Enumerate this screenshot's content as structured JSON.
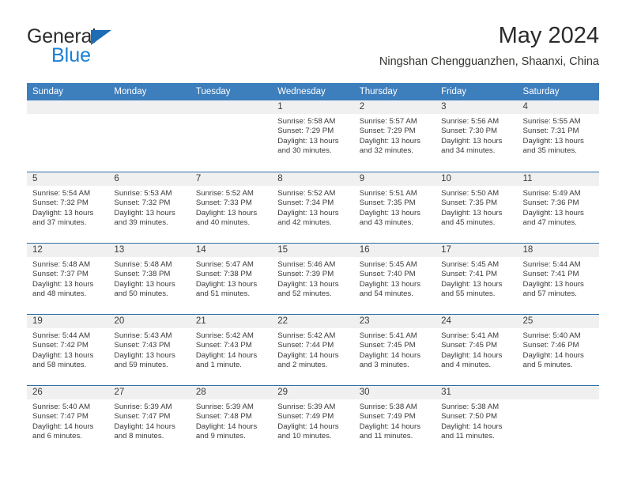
{
  "brand": {
    "name_top": "General",
    "name_bottom": "Blue",
    "triangle_color": "#1e6cb5",
    "blue_text_color": "#1a7fd4"
  },
  "header": {
    "title": "May 2024",
    "subtitle": "Ningshan Chengguanzhen, Shaanxi, China"
  },
  "theme": {
    "header_bar_color": "#3d7ebd",
    "row_divider_color": "#2e6fa8",
    "date_band_color": "#f0f0f0",
    "text_color": "#3a3a3a"
  },
  "weekdays": [
    "Sunday",
    "Monday",
    "Tuesday",
    "Wednesday",
    "Thursday",
    "Friday",
    "Saturday"
  ],
  "weeks": [
    [
      {
        "day": "",
        "empty": true
      },
      {
        "day": "",
        "empty": true
      },
      {
        "day": "",
        "empty": true
      },
      {
        "day": "1",
        "sunrise": "Sunrise: 5:58 AM",
        "sunset": "Sunset: 7:29 PM",
        "daylight": "Daylight: 13 hours and 30 minutes."
      },
      {
        "day": "2",
        "sunrise": "Sunrise: 5:57 AM",
        "sunset": "Sunset: 7:29 PM",
        "daylight": "Daylight: 13 hours and 32 minutes."
      },
      {
        "day": "3",
        "sunrise": "Sunrise: 5:56 AM",
        "sunset": "Sunset: 7:30 PM",
        "daylight": "Daylight: 13 hours and 34 minutes."
      },
      {
        "day": "4",
        "sunrise": "Sunrise: 5:55 AM",
        "sunset": "Sunset: 7:31 PM",
        "daylight": "Daylight: 13 hours and 35 minutes."
      }
    ],
    [
      {
        "day": "5",
        "sunrise": "Sunrise: 5:54 AM",
        "sunset": "Sunset: 7:32 PM",
        "daylight": "Daylight: 13 hours and 37 minutes."
      },
      {
        "day": "6",
        "sunrise": "Sunrise: 5:53 AM",
        "sunset": "Sunset: 7:32 PM",
        "daylight": "Daylight: 13 hours and 39 minutes."
      },
      {
        "day": "7",
        "sunrise": "Sunrise: 5:52 AM",
        "sunset": "Sunset: 7:33 PM",
        "daylight": "Daylight: 13 hours and 40 minutes."
      },
      {
        "day": "8",
        "sunrise": "Sunrise: 5:52 AM",
        "sunset": "Sunset: 7:34 PM",
        "daylight": "Daylight: 13 hours and 42 minutes."
      },
      {
        "day": "9",
        "sunrise": "Sunrise: 5:51 AM",
        "sunset": "Sunset: 7:35 PM",
        "daylight": "Daylight: 13 hours and 43 minutes."
      },
      {
        "day": "10",
        "sunrise": "Sunrise: 5:50 AM",
        "sunset": "Sunset: 7:35 PM",
        "daylight": "Daylight: 13 hours and 45 minutes."
      },
      {
        "day": "11",
        "sunrise": "Sunrise: 5:49 AM",
        "sunset": "Sunset: 7:36 PM",
        "daylight": "Daylight: 13 hours and 47 minutes."
      }
    ],
    [
      {
        "day": "12",
        "sunrise": "Sunrise: 5:48 AM",
        "sunset": "Sunset: 7:37 PM",
        "daylight": "Daylight: 13 hours and 48 minutes."
      },
      {
        "day": "13",
        "sunrise": "Sunrise: 5:48 AM",
        "sunset": "Sunset: 7:38 PM",
        "daylight": "Daylight: 13 hours and 50 minutes."
      },
      {
        "day": "14",
        "sunrise": "Sunrise: 5:47 AM",
        "sunset": "Sunset: 7:38 PM",
        "daylight": "Daylight: 13 hours and 51 minutes."
      },
      {
        "day": "15",
        "sunrise": "Sunrise: 5:46 AM",
        "sunset": "Sunset: 7:39 PM",
        "daylight": "Daylight: 13 hours and 52 minutes."
      },
      {
        "day": "16",
        "sunrise": "Sunrise: 5:45 AM",
        "sunset": "Sunset: 7:40 PM",
        "daylight": "Daylight: 13 hours and 54 minutes."
      },
      {
        "day": "17",
        "sunrise": "Sunrise: 5:45 AM",
        "sunset": "Sunset: 7:41 PM",
        "daylight": "Daylight: 13 hours and 55 minutes."
      },
      {
        "day": "18",
        "sunrise": "Sunrise: 5:44 AM",
        "sunset": "Sunset: 7:41 PM",
        "daylight": "Daylight: 13 hours and 57 minutes."
      }
    ],
    [
      {
        "day": "19",
        "sunrise": "Sunrise: 5:44 AM",
        "sunset": "Sunset: 7:42 PM",
        "daylight": "Daylight: 13 hours and 58 minutes."
      },
      {
        "day": "20",
        "sunrise": "Sunrise: 5:43 AM",
        "sunset": "Sunset: 7:43 PM",
        "daylight": "Daylight: 13 hours and 59 minutes."
      },
      {
        "day": "21",
        "sunrise": "Sunrise: 5:42 AM",
        "sunset": "Sunset: 7:43 PM",
        "daylight": "Daylight: 14 hours and 1 minute."
      },
      {
        "day": "22",
        "sunrise": "Sunrise: 5:42 AM",
        "sunset": "Sunset: 7:44 PM",
        "daylight": "Daylight: 14 hours and 2 minutes."
      },
      {
        "day": "23",
        "sunrise": "Sunrise: 5:41 AM",
        "sunset": "Sunset: 7:45 PM",
        "daylight": "Daylight: 14 hours and 3 minutes."
      },
      {
        "day": "24",
        "sunrise": "Sunrise: 5:41 AM",
        "sunset": "Sunset: 7:45 PM",
        "daylight": "Daylight: 14 hours and 4 minutes."
      },
      {
        "day": "25",
        "sunrise": "Sunrise: 5:40 AM",
        "sunset": "Sunset: 7:46 PM",
        "daylight": "Daylight: 14 hours and 5 minutes."
      }
    ],
    [
      {
        "day": "26",
        "sunrise": "Sunrise: 5:40 AM",
        "sunset": "Sunset: 7:47 PM",
        "daylight": "Daylight: 14 hours and 6 minutes."
      },
      {
        "day": "27",
        "sunrise": "Sunrise: 5:39 AM",
        "sunset": "Sunset: 7:47 PM",
        "daylight": "Daylight: 14 hours and 8 minutes."
      },
      {
        "day": "28",
        "sunrise": "Sunrise: 5:39 AM",
        "sunset": "Sunset: 7:48 PM",
        "daylight": "Daylight: 14 hours and 9 minutes."
      },
      {
        "day": "29",
        "sunrise": "Sunrise: 5:39 AM",
        "sunset": "Sunset: 7:49 PM",
        "daylight": "Daylight: 14 hours and 10 minutes."
      },
      {
        "day": "30",
        "sunrise": "Sunrise: 5:38 AM",
        "sunset": "Sunset: 7:49 PM",
        "daylight": "Daylight: 14 hours and 11 minutes."
      },
      {
        "day": "31",
        "sunrise": "Sunrise: 5:38 AM",
        "sunset": "Sunset: 7:50 PM",
        "daylight": "Daylight: 14 hours and 11 minutes."
      },
      {
        "day": "",
        "empty": true
      }
    ]
  ]
}
